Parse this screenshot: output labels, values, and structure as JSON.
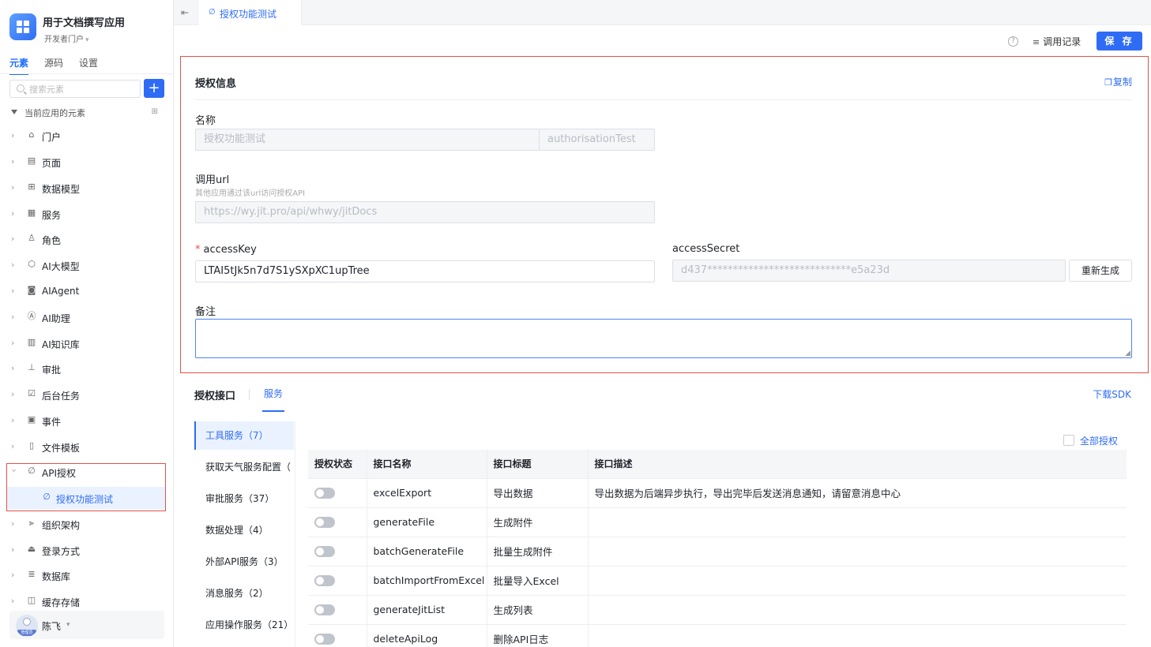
{
  "app": {
    "title": "用于文档撰写应用",
    "portal": "开发者门户"
  },
  "sidebar": {
    "tabs": [
      "元素",
      "源码",
      "设置"
    ],
    "search_placeholder": "搜索元素",
    "tree_heading": "当前应用的元素",
    "items": [
      {
        "label": "门户",
        "icon": "portal-icon"
      },
      {
        "label": "页面",
        "icon": "page-icon"
      },
      {
        "label": "数据模型",
        "icon": "table-icon"
      },
      {
        "label": "服务",
        "icon": "service-icon"
      },
      {
        "label": "角色",
        "icon": "role-icon"
      },
      {
        "label": "AI大模型",
        "icon": "ai-model-icon"
      },
      {
        "label": "AIAgent",
        "icon": "robot-icon"
      },
      {
        "label": "AI助理",
        "icon": "ai-assistant-icon"
      },
      {
        "label": "AI知识库",
        "icon": "book-icon"
      },
      {
        "label": "审批",
        "icon": "approval-icon"
      },
      {
        "label": "后台任务",
        "icon": "task-icon"
      },
      {
        "label": "事件",
        "icon": "event-icon"
      },
      {
        "label": "文件模板",
        "icon": "file-template-icon"
      },
      {
        "label": "API授权",
        "icon": "api-icon"
      },
      {
        "label": "授权功能测试",
        "icon": "api-icon"
      },
      {
        "label": "组织架构",
        "icon": "org-icon"
      },
      {
        "label": "登录方式",
        "icon": "login-icon"
      },
      {
        "label": "数据库",
        "icon": "database-icon"
      },
      {
        "label": "缓存存储",
        "icon": "cache-icon"
      }
    ],
    "user": {
      "name": "陈飞",
      "role_badge": "管理员"
    }
  },
  "topbar": {
    "tab_label": "授权功能测试",
    "log_label": "调用记录",
    "save_label": "保 存"
  },
  "auth": {
    "section_title": "授权信息",
    "copy_label": "复制",
    "name_label": "名称",
    "name_value": "授权功能测试",
    "name_code": "authorisationTest",
    "url_label": "调用url",
    "url_hint": "其他应用通过该url访问授权API",
    "url_value": "https://wy.jit.pro/api/whwy/jitDocs",
    "access_key_label": "accessKey",
    "access_key_value": "LTAI5tJk5n7d7S1ySXpXC1upTree",
    "access_secret_label": "accessSecret",
    "access_secret_value": "d437****************************e5a23d",
    "regen_label": "重新生成",
    "remark_label": "备注",
    "remark_value": ""
  },
  "interfaces": {
    "title": "授权接口",
    "tab": "服务",
    "sdk_label": "下载SDK",
    "all_auth_label": "全部授权",
    "services": [
      "工具服务（7）",
      "获取天气服务配置（",
      "审批服务（37）",
      "数据处理（4）",
      "外部API服务（3）",
      "消息服务（2）",
      "应用操作服务（21）"
    ],
    "columns": [
      "授权状态",
      "接口名称",
      "接口标题",
      "接口描述"
    ],
    "rows": [
      {
        "name": "excelExport",
        "title": "导出数据",
        "desc": "导出数据为后端异步执行，导出完毕后发送消息通知，请留意消息中心",
        "enabled": false
      },
      {
        "name": "generateFile",
        "title": "生成附件",
        "desc": "",
        "enabled": false
      },
      {
        "name": "batchGenerateFile",
        "title": "批量生成附件",
        "desc": "",
        "enabled": false
      },
      {
        "name": "batchImportFromExcel",
        "title": "批量导入Excel",
        "desc": "",
        "enabled": false
      },
      {
        "name": "generateJitList",
        "title": "生成列表",
        "desc": "",
        "enabled": false
      },
      {
        "name": "deleteApiLog",
        "title": "删除API日志",
        "desc": "",
        "enabled": false
      }
    ]
  },
  "colors": {
    "accent": "#2f6cf5",
    "highlight_border": "#e0534a"
  }
}
